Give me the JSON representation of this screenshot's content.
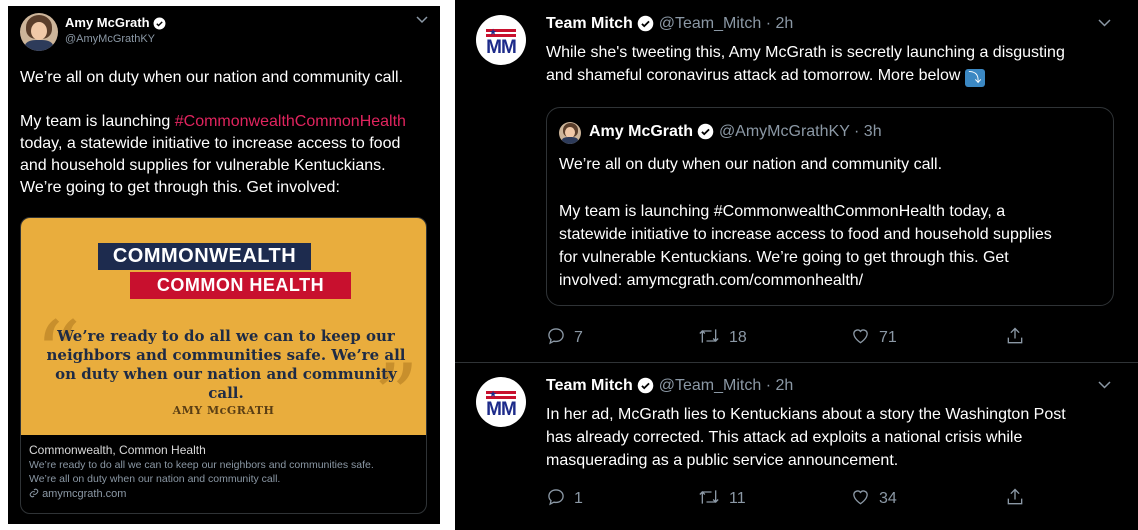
{
  "left": {
    "name": "Amy McGrath",
    "handle": "@AmyMcGrathKY",
    "text_line1": "We’re all on duty when our nation and community call.",
    "text_line2_pre": "My team is launching ",
    "hashtag": "#CommonwealthCommonHealth",
    "text_line3": " today, a statewide initiative to increase access to food",
    "text_line4": "and household supplies for vulnerable Kentuckians.",
    "text_line5": "We’re going to get through this. Get involved:",
    "card": {
      "banner_line1": "COMMONWEALTH",
      "banner_line2": "COMMON HEALTH",
      "quote": "We’re ready to do all we can to keep our neighbors and communities safe. We’re all on duty when our nation and community call.",
      "author": "AMY McGRATH",
      "title": "Commonwealth, Common Health",
      "desc_line1": "We’re ready to do all we can to keep our neighbors and communities safe.",
      "desc_line2": "We’re all on duty when our nation and community call.",
      "link": "amymcgrath.com"
    }
  },
  "right": {
    "tweet1": {
      "name": "Team Mitch",
      "handle": "@Team_Mitch",
      "time": "· 2h",
      "line1": "While she's tweeting this, Amy McGrath is secretly launching a disgusting",
      "line2": "and shameful coronavirus attack ad tomorrow. More below",
      "quoted": {
        "name": "Amy McGrath",
        "handle": "@AmyMcGrathKY",
        "time": "· 3h",
        "line1": "We’re all on duty when our nation and community call.",
        "line2": "My team is launching #CommonwealthCommonHealth today, a",
        "line3": "statewide initiative to increase access to food and household supplies",
        "line4": "for vulnerable Kentuckians. We’re going to get through this. Get",
        "line5": "involved: amymcgrath.com/commonhealth/"
      },
      "replies": "7",
      "retweets": "18",
      "likes": "71"
    },
    "tweet2": {
      "name": "Team Mitch",
      "handle": "@Team_Mitch",
      "time": "· 2h",
      "line1": "In her ad, McGrath lies to Kentuckians about a story the Washington Post",
      "line2": "has already corrected. This attack ad exploits a national crisis while",
      "line3": "masquerading as a public service announcement.",
      "replies": "1",
      "retweets": "11",
      "likes": "34"
    },
    "logo_text": "MM"
  },
  "colors": {
    "background": "#000000",
    "hashtag": "#e0245e",
    "muted": "#8b98a5",
    "card_bg": "#e9ad3d",
    "navy": "#1d2b4e",
    "red": "#c8102e"
  },
  "icons": [
    "verified-badge-icon",
    "chevron-down-icon",
    "link-icon",
    "reply-icon",
    "retweet-icon",
    "like-icon",
    "share-icon",
    "return-arrow-icon"
  ]
}
